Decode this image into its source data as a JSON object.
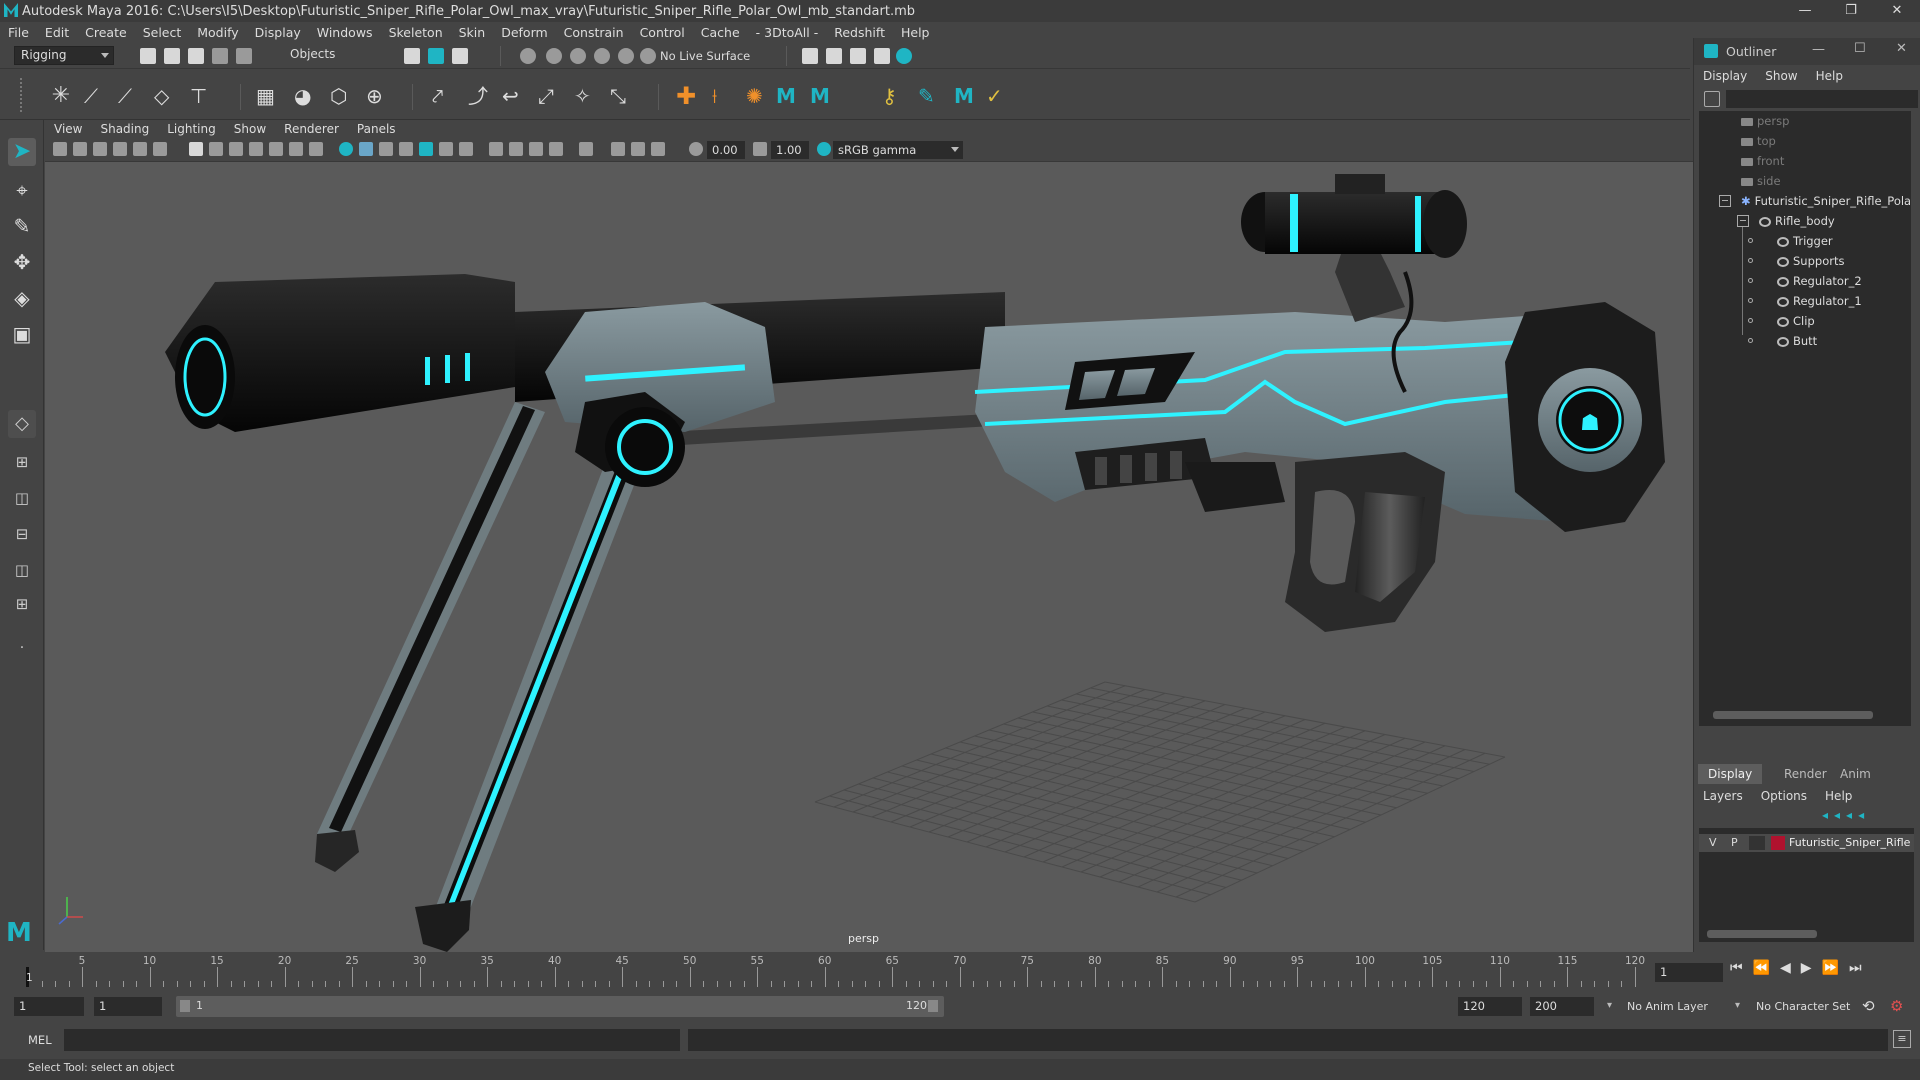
{
  "window": {
    "title": "Autodesk Maya 2016: C:\\Users\\I5\\Desktop\\Futuristic_Sniper_Rifle_Polar_Owl_max_vray\\Futuristic_Sniper_Rifle_Polar_Owl_mb_standart.mb",
    "controls": [
      "—",
      "❐",
      "✕"
    ]
  },
  "menubar": [
    "File",
    "Edit",
    "Create",
    "Select",
    "Modify",
    "Display",
    "Windows",
    "Skeleton",
    "Skin",
    "Deform",
    "Constrain",
    "Control",
    "Cache",
    "- 3DtoAll -",
    "Redshift",
    "Help"
  ],
  "statusline": {
    "mode": "Rigging",
    "selection_mode": "Objects",
    "live_surface": "No Live Surface"
  },
  "viewport": {
    "menu": [
      "View",
      "Shading",
      "Lighting",
      "Show",
      "Renderer",
      "Panels"
    ],
    "exposure": "0.00",
    "gamma": "1.00",
    "color_space": "sRGB gamma",
    "camera_label": "persp"
  },
  "outliner": {
    "title": "Outliner",
    "menu": [
      "Display",
      "Show",
      "Help"
    ],
    "items": [
      {
        "label": "persp",
        "kind": "camera"
      },
      {
        "label": "top",
        "kind": "camera"
      },
      {
        "label": "front",
        "kind": "camera"
      },
      {
        "label": "side",
        "kind": "camera"
      },
      {
        "label": "Futuristic_Sniper_Rifle_Polar_",
        "kind": "root"
      },
      {
        "label": "Rifle_body",
        "kind": "joint"
      },
      {
        "label": "Trigger",
        "kind": "joint"
      },
      {
        "label": "Supports",
        "kind": "joint"
      },
      {
        "label": "Regulator_2",
        "kind": "joint"
      },
      {
        "label": "Regulator_1",
        "kind": "joint"
      },
      {
        "label": "Clip",
        "kind": "joint"
      },
      {
        "label": "Butt",
        "kind": "joint"
      }
    ]
  },
  "layer_editor": {
    "tabs": [
      "Display",
      "Render",
      "Anim"
    ],
    "menu": [
      "Layers",
      "Options",
      "Help"
    ],
    "layer": {
      "v": "V",
      "p": "P",
      "name": "Futuristic_Sniper_Rifle",
      "color": "#b0122e"
    }
  },
  "timeline": {
    "ticks": [
      "5",
      "10",
      "15",
      "20",
      "25",
      "30",
      "35",
      "40",
      "45",
      "50",
      "55",
      "60",
      "65",
      "70",
      "75",
      "80",
      "85",
      "90",
      "95",
      "100",
      "105",
      "110",
      "115",
      "120"
    ],
    "start_marker": "1",
    "current_frame": "1"
  },
  "range": {
    "start": "1",
    "playback_start": "1",
    "slider_start": "1",
    "slider_end": "120",
    "playback_end": "120",
    "end": "200",
    "anim_layer": "No Anim Layer",
    "character_set": "No Character Set"
  },
  "command": {
    "lang": "MEL"
  },
  "helpline": "Select Tool: select an object",
  "colors": {
    "accent": "#1fb5c4",
    "glow": "#2ef2ff",
    "viewport_bg": "#5a5a5a"
  }
}
